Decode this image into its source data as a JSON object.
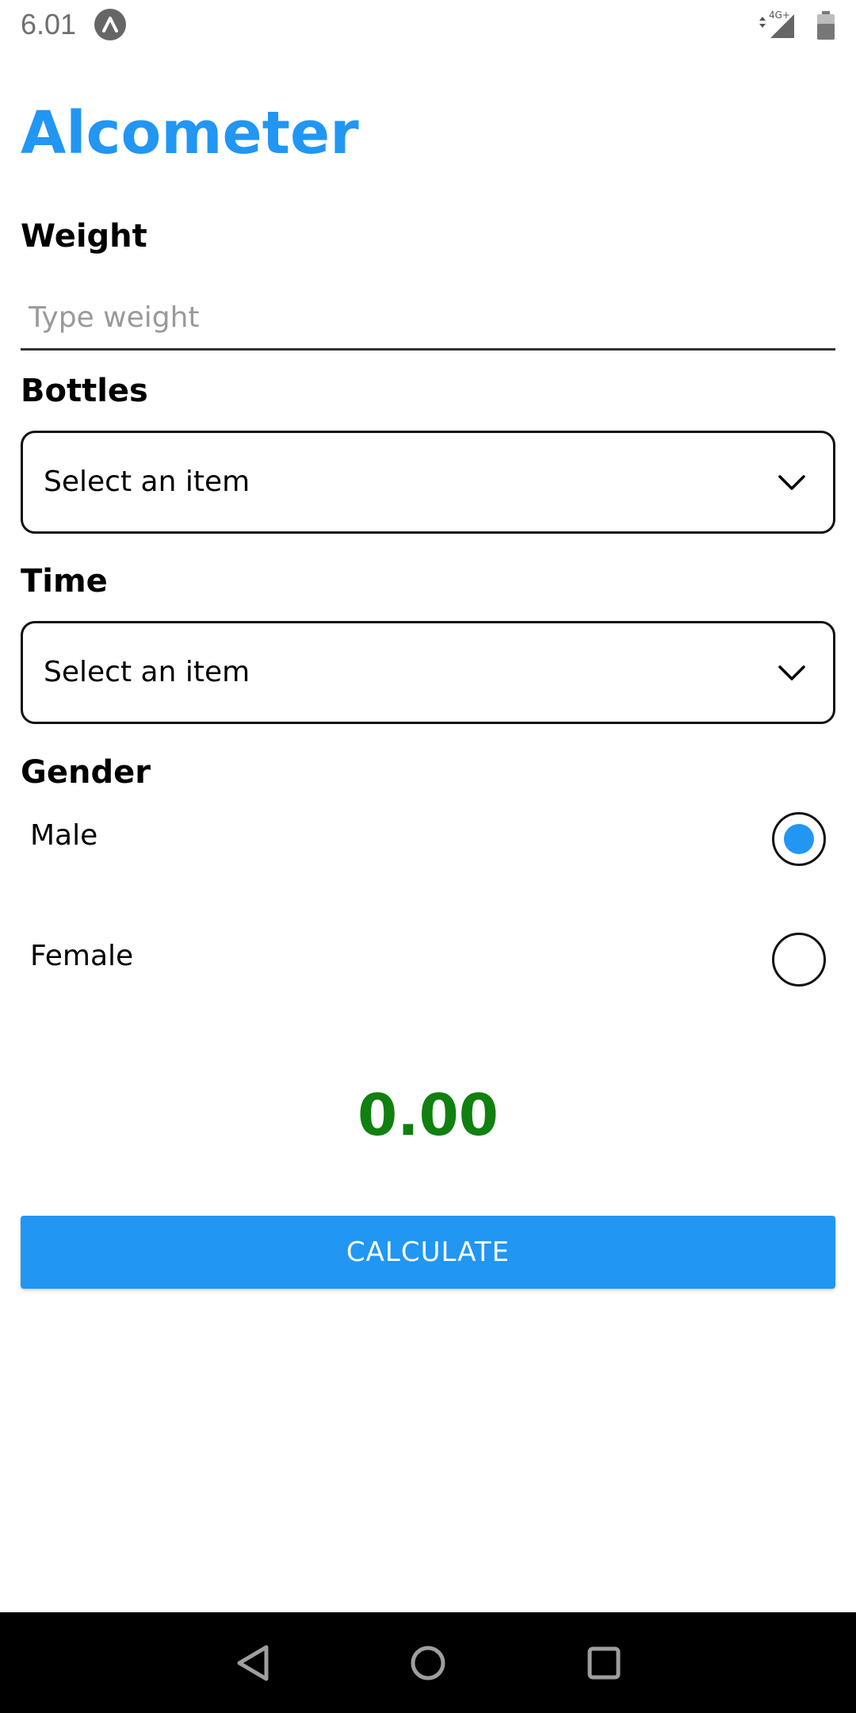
{
  "status_bar": {
    "time": "6.01",
    "network_label": "4G+",
    "icons": [
      "app-notification-icon",
      "network-signal-icon",
      "battery-icon"
    ]
  },
  "app": {
    "title": "Alcometer"
  },
  "weight": {
    "label": "Weight",
    "value": "",
    "placeholder": "Type weight"
  },
  "bottles": {
    "label": "Bottles",
    "selected": "Select an item"
  },
  "time": {
    "label": "Time",
    "selected": "Select an item"
  },
  "gender": {
    "label": "Gender",
    "options": [
      {
        "label": "Male",
        "selected": true
      },
      {
        "label": "Female",
        "selected": false
      }
    ]
  },
  "result": {
    "value": "0.00"
  },
  "calculate_button": {
    "label": "CALCULATE"
  },
  "nav_bar": {
    "icons": [
      "back-icon",
      "home-icon",
      "recents-icon"
    ]
  },
  "colors": {
    "accent": "#2196F3",
    "result_green": "#108010"
  }
}
